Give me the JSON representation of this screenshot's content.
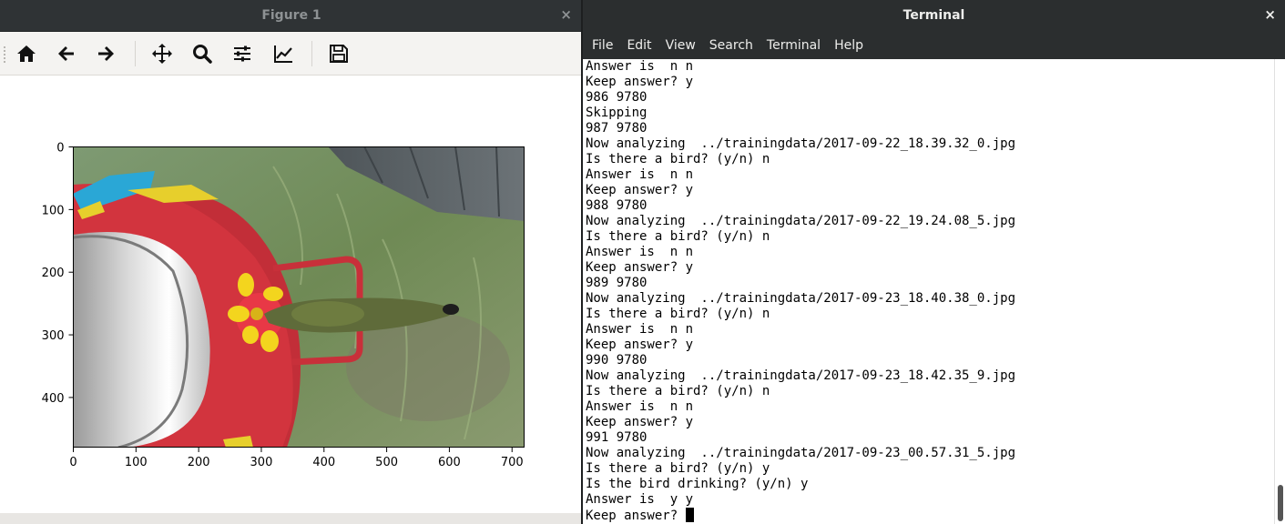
{
  "figure": {
    "title": "Figure 1",
    "close": "×",
    "toolbar": {
      "icons": [
        "home-icon",
        "back-arrow-icon",
        "forward-arrow-icon",
        "pan-icon",
        "zoom-icon",
        "subplots-icon",
        "edit-curves-icon",
        "save-icon"
      ]
    },
    "axes": {
      "x_ticks": [
        "0",
        "100",
        "200",
        "300",
        "400",
        "500",
        "600",
        "700"
      ],
      "y_ticks": [
        "0",
        "100",
        "200",
        "300",
        "400"
      ],
      "xlim": [
        0,
        720
      ],
      "ylim": [
        480,
        0
      ]
    },
    "image_description_colors": {
      "grass": "#6e8a55",
      "feeder_red": "#c8303a",
      "flower_yellow": "#f2d21c",
      "bird_green": "#5e6a3a",
      "fence": "#5b6266"
    }
  },
  "terminal": {
    "title": "Terminal",
    "close": "×",
    "menu": [
      "File",
      "Edit",
      "View",
      "Search",
      "Terminal",
      "Help"
    ],
    "lines": [
      "Answer is  n n",
      "Keep answer? y",
      "986 9780",
      "Skipping",
      "987 9780",
      "Now analyzing  ../trainingdata/2017-09-22_18.39.32_0.jpg",
      "Is there a bird? (y/n) n",
      "Answer is  n n",
      "Keep answer? y",
      "988 9780",
      "Now analyzing  ../trainingdata/2017-09-22_19.24.08_5.jpg",
      "Is there a bird? (y/n) n",
      "Answer is  n n",
      "Keep answer? y",
      "989 9780",
      "Now analyzing  ../trainingdata/2017-09-23_18.40.38_0.jpg",
      "Is there a bird? (y/n) n",
      "Answer is  n n",
      "Keep answer? y",
      "990 9780",
      "Now analyzing  ../trainingdata/2017-09-23_18.42.35_9.jpg",
      "Is there a bird? (y/n) n",
      "Answer is  n n",
      "Keep answer? y",
      "991 9780",
      "Now analyzing  ../trainingdata/2017-09-23_00.57.31_5.jpg",
      "Is there a bird? (y/n) y",
      "Is the bird drinking? (y/n) y",
      "Answer is  y y"
    ],
    "prompt_line": "Keep answer? "
  }
}
